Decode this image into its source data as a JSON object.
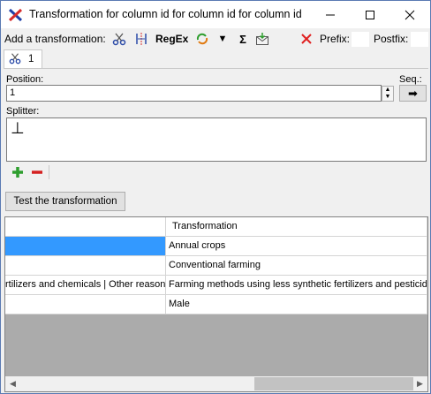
{
  "window": {
    "title": "Transformation for column id for column id for column id",
    "buttons": {
      "minimize": "—",
      "maximize": "☐",
      "close": "✕"
    }
  },
  "toolbar": {
    "add_label": "Add a transformation:",
    "icons": [
      "scissors-icon",
      "split-icon",
      "regex-icon",
      "replace-icon",
      "filter-icon",
      "sum-icon",
      "mail-icon"
    ],
    "regex_label": "RegEx",
    "sum_label": "Σ",
    "filter_label": "▼",
    "prefix_label": "Prefix:",
    "postfix_label": "Postfix:",
    "prefix_value": "",
    "postfix_value": ""
  },
  "tab": {
    "label": "1"
  },
  "panel": {
    "position_label": "Position:",
    "position_value": "1",
    "seq_label": "Seq.:",
    "seq_button": "➡",
    "splitter_label": "Splitter:",
    "splitter_value": "⊥"
  },
  "test_button": "Test the transformation",
  "grid": {
    "columns": [
      "",
      "Transformation"
    ],
    "rows": [
      [
        "",
        "Annual crops"
      ],
      [
        "",
        "Conventional farming"
      ],
      [
        "rtilizers and chemicals | Other reasons",
        "Farming methods using less synthetic fertilizers and pesticides"
      ],
      [
        "",
        "Male"
      ]
    ],
    "selected_color": "#3399ff",
    "scroll_left": "◀",
    "scroll_right": "▶"
  },
  "colors": {
    "accent_selected": "#3399ff",
    "add_green": "#2e9e2e",
    "remove_red": "#d42020",
    "delete_red": "#e02020"
  }
}
